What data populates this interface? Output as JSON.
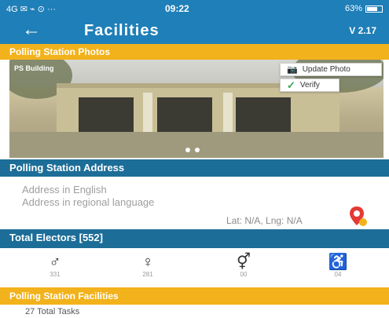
{
  "status_bar": {
    "left_icons": "4G ✉ ⌁ ⊙ ···",
    "time": "09:22",
    "battery_text": "63%"
  },
  "app_bar": {
    "back_icon": "arrow-left-icon",
    "title": "Facilities",
    "version": "V 2.17"
  },
  "photos_section": {
    "header": "Polling Station Photos",
    "photo_caption": "PS Building",
    "update_photo_label": "Update Photo",
    "verify_label": "Verify"
  },
  "address_section": {
    "header": "Polling Station Address",
    "address_english": "Address in English",
    "address_regional": "Address in regional language",
    "lat_lng": "Lat: N/A, Lng: N/A"
  },
  "electors_section": {
    "header": "Total Electors [552]",
    "items": [
      {
        "icon": "male-icon",
        "count": "331"
      },
      {
        "icon": "female-icon",
        "count": "281"
      },
      {
        "icon": "third-gender-icon",
        "count": "00"
      },
      {
        "icon": "pwd-wheelchair-icon",
        "count": "04"
      }
    ]
  },
  "facilities_section": {
    "header": "Polling Station Facilities",
    "total_tasks": "27 Total Tasks"
  },
  "colors": {
    "primary_blue": "#1f7fb8",
    "dark_blue": "#1c6d97",
    "accent_yellow": "#f2b21b"
  }
}
